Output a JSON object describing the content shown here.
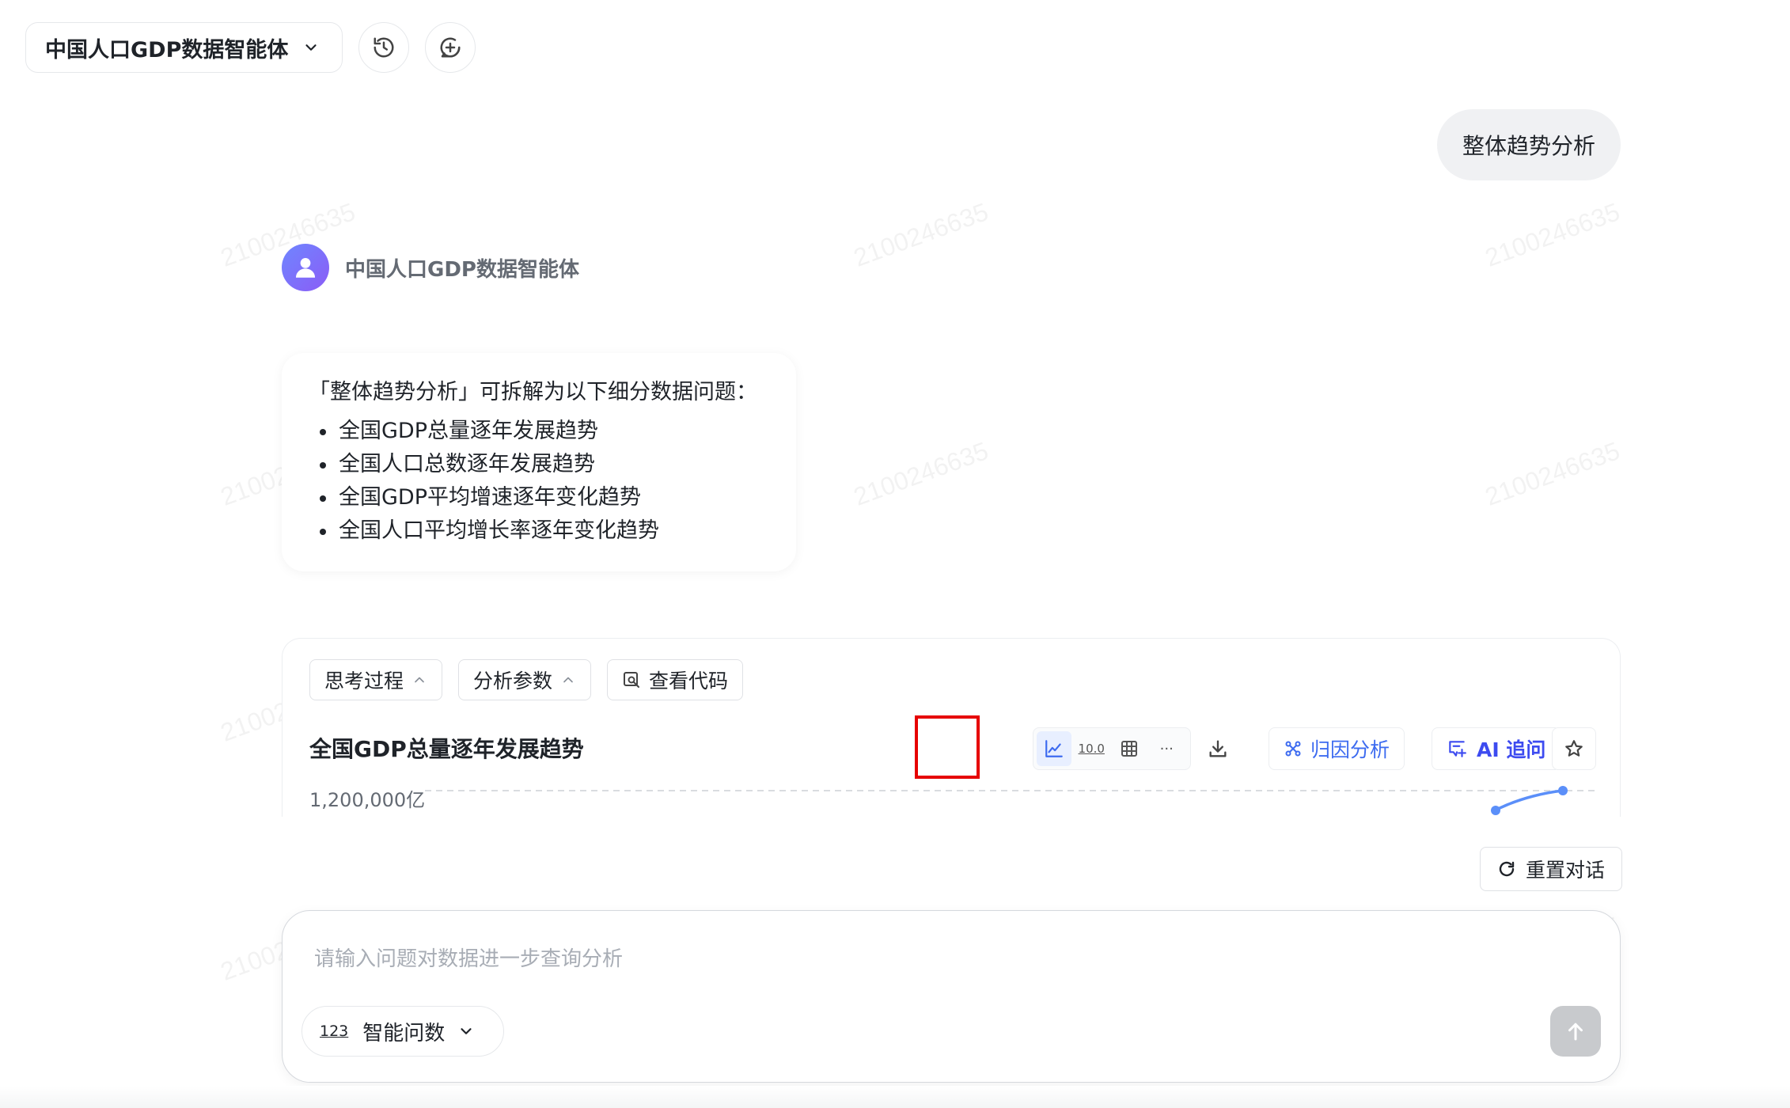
{
  "header": {
    "agent_name": "中国人口GDP数据智能体",
    "icons": [
      "chevron-down-icon",
      "history-icon",
      "new-chat-icon"
    ]
  },
  "watermark": "2100246635",
  "conversation": {
    "user_message": "整体趋势分析",
    "agent_name": "中国人口GDP数据智能体",
    "answer_intro": "「整体趋势分析」可拆解为以下细分数据问题：",
    "answer_items": [
      "全国GDP总量逐年发展趋势",
      "全国人口总数逐年发展趋势",
      "全国GDP平均增速逐年变化趋势",
      "全国人口平均增长率逐年变化趋势"
    ]
  },
  "panel": {
    "chips": {
      "thinking": "思考过程",
      "params": "分析参数",
      "code": "查看代码"
    },
    "title": "全国GDP总量逐年发展趋势",
    "view_icons": [
      "line-chart-icon",
      "number-icon",
      "table-icon",
      "more-icon"
    ],
    "number_icon_text": "10.0",
    "more_icon_text": "···",
    "download_icon": "download-icon",
    "attribution_label": "归因分析",
    "ai_followup_label": "AI 追问",
    "y_tick_label": "1,200,000亿"
  },
  "chart_data": {
    "type": "line",
    "y_tick_labels": [
      "1,200,000亿"
    ],
    "note": "partially visible",
    "colors": {
      "line": "#5b8ff9"
    }
  },
  "reset_label": "重置对话",
  "input": {
    "placeholder": "请输入问题对数据进一步查询分析",
    "value": "",
    "mode_icon_text": "123",
    "mode_label": "智能问数"
  },
  "colors": {
    "accent": "#3d6bf0",
    "highlight": "#e60000",
    "send_disabled": "#c8cacd"
  }
}
